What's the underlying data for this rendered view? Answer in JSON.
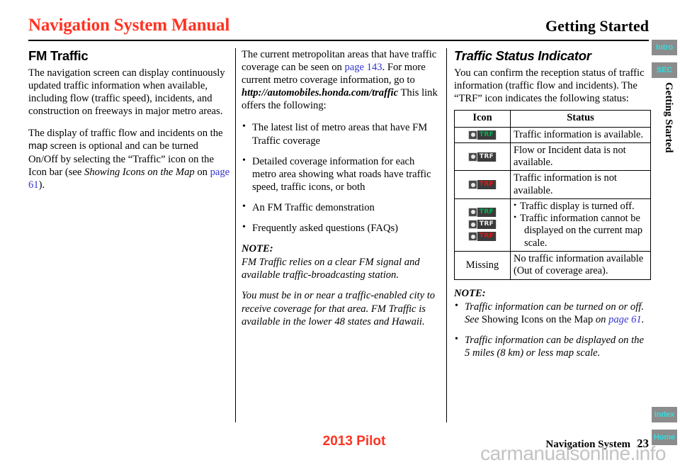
{
  "header": {
    "title": "Navigation System Manual",
    "section": "Getting Started"
  },
  "col1": {
    "heading": "FM Traffic",
    "para1": "The navigation screen can display continuously updated traffic information when available, including flow (traffic speed), incidents, and construction on freeways in major metro areas.",
    "para2_a": "The display of traffic flow and incidents on the ",
    "para2_screen": "map",
    "para2_b": " screen is optional and can be turned On/Off by selecting the “Traffic” icon on the Icon bar (see ",
    "para2_italic": "Showing Icons on the Map",
    "para2_c": " on ",
    "para2_link": "page 61",
    "para2_d": ")."
  },
  "col2": {
    "para1_a": "The current metropolitan areas that have traffic coverage can be seen on ",
    "para1_link": "page 143",
    "para1_b": ". For more current metro coverage information, go to ",
    "para1_url": "http://automobiles.honda.com/traffic",
    "para1_c": " This link offers the following:",
    "bullets": [
      "The latest list of metro areas that have FM Traffic coverage",
      "Detailed coverage information for each metro area showing what roads have traffic speed, traffic icons, or both",
      "An FM Traffic demonstration",
      "Frequently asked questions (FAQs)"
    ],
    "note_label": "NOTE:",
    "note_para1": "FM Traffic relies on a clear FM signal and available traffic-broadcasting station.",
    "note_para2": "You must be in or near a traffic-enabled city to receive coverage for that area. FM Traffic is available in the lower 48 states and Hawaii."
  },
  "col3": {
    "heading": "Traffic Status Indicator",
    "para1": "You can confirm the reception status of traffic information (traffic flow and incidents). The “TRF” icon indicates the following status:",
    "table": {
      "headers": [
        "Icon",
        "Status"
      ],
      "rows": [
        {
          "icon": "trf-icon-green",
          "icon_label": "TRF",
          "icon_color": "#00b050",
          "status": "Traffic information is available."
        },
        {
          "icon": "trf-icon-white",
          "icon_label": "TRF",
          "icon_color": "#f2f2f2",
          "status": "Flow or Incident data is not available."
        },
        {
          "icon": "trf-icon-red",
          "icon_label": "TRF",
          "icon_color": "#ee1111",
          "status": "Traffic information is not available."
        },
        {
          "icon": "trf-icon-stack",
          "icon_label": "TRF",
          "status_bullets": [
            "Traffic display is turned off.",
            "Traffic information cannot be"
          ],
          "status_bullet2_cont": "displayed on the current map scale."
        },
        {
          "icon_text": "Missing",
          "status": "No traffic information available (Out of coverage area)."
        }
      ]
    },
    "note_label": "NOTE:",
    "note_bullets": [
      {
        "a": "Traffic information can be turned on or off. See ",
        "upright": "Showing Icons on the Map",
        "b": " on ",
        "link": "page 61",
        "c": "."
      },
      {
        "a": "Traffic information can be displayed on the 5 miles (8 km) or less map scale.",
        "upright": "",
        "b": "",
        "link": "",
        "c": ""
      }
    ]
  },
  "rail": {
    "tabs": [
      {
        "label": "Intro"
      },
      {
        "label": "SEC"
      },
      {
        "label": "Index"
      },
      {
        "label": "Home"
      }
    ],
    "vertical_label": "Getting Started",
    "tab_bg": "#8c8c8c",
    "tab_color": "#33dddd"
  },
  "footer": {
    "model": "2013 Pilot",
    "section": "Navigation System",
    "page": "23",
    "watermark": "carmanualsonline.info"
  }
}
